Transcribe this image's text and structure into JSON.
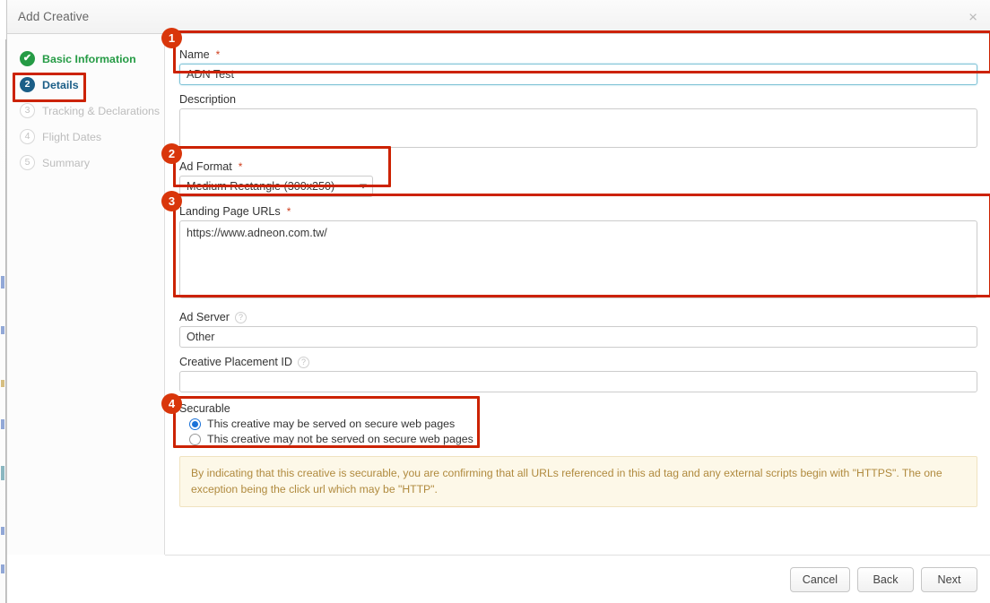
{
  "window": {
    "title": "Add Creative",
    "close_icon": "close-icon",
    "close_glyph": "×"
  },
  "sidebar": {
    "steps": [
      {
        "num": "✔",
        "label": "Basic Information",
        "state": "done"
      },
      {
        "num": "2",
        "label": "Details",
        "state": "active"
      },
      {
        "num": "3",
        "label": "Tracking & Declarations",
        "state": "todo"
      },
      {
        "num": "4",
        "label": "Flight Dates",
        "state": "todo"
      },
      {
        "num": "5",
        "label": "Summary",
        "state": "todo"
      }
    ]
  },
  "annotations": {
    "badges": [
      "1",
      "2",
      "3",
      "4"
    ]
  },
  "form": {
    "name": {
      "label": "Name",
      "required_mark": "*",
      "value": "ADN Test",
      "placeholder": ""
    },
    "description": {
      "label": "Description",
      "value": "",
      "placeholder": ""
    },
    "ad_format": {
      "label": "Ad Format",
      "required_mark": "*",
      "selected": "Medium Rectangle (300x250)",
      "options": [
        "Medium Rectangle (300x250)"
      ],
      "chevron_icon": "chevron-down-icon"
    },
    "landing_page_urls": {
      "label": "Landing Page URLs",
      "required_mark": "*",
      "value": "https://www.adneon.com.tw/",
      "placeholder": ""
    },
    "ad_server": {
      "label": "Ad Server",
      "help_icon": "help-icon",
      "help_glyph": "?",
      "value": "Other",
      "placeholder": ""
    },
    "creative_placement_id": {
      "label": "Creative Placement ID",
      "help_icon": "help-icon",
      "help_glyph": "?",
      "value": "",
      "placeholder": ""
    },
    "securable": {
      "label": "Securable",
      "options": [
        {
          "label": "This creative may be served on secure web pages",
          "selected": true
        },
        {
          "label": "This creative may not be served on secure web pages",
          "selected": false
        }
      ]
    },
    "warning": "By indicating that this creative is securable, you are confirming that all URLs referenced in this ad tag and any external scripts begin with \"HTTPS\". The one exception being the click url which may be \"HTTP\"."
  },
  "footer": {
    "cancel_label": "Cancel",
    "back_label": "Back",
    "next_label": "Next"
  },
  "colors": {
    "annotation_red": "#cc2200",
    "badge_red": "#d9360b",
    "step_done_green": "#259b45",
    "step_active_blue": "#1b5e87",
    "radio_blue": "#1b72d8",
    "warning_bg": "#fdf8e8",
    "warning_text": "#b08a3e"
  }
}
